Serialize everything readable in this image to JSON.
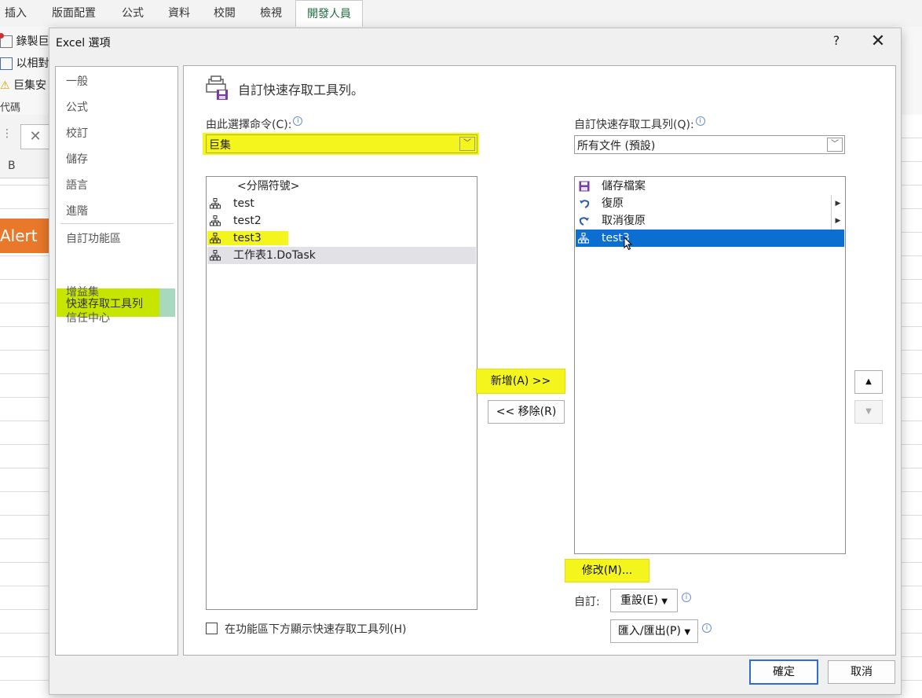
{
  "excel": {
    "tabs": [
      "插入",
      "版面配置",
      "公式",
      "資料",
      "校閱",
      "檢視",
      "開發人員"
    ],
    "active_tab": "開發人員",
    "ribbon_items": [
      "錄製巨",
      "以相對",
      "巨集安"
    ],
    "ribbon_code_label": "代碼",
    "column_b": "B",
    "orange_button_text": "Alert m"
  },
  "dialog": {
    "title": "Excel 選項",
    "help": "?",
    "close": "✕",
    "nav": [
      "一般",
      "公式",
      "校訂",
      "儲存",
      "語言",
      "進階",
      "自訂功能區",
      "快速存取工具列",
      "增益集",
      "信任中心"
    ],
    "header": "自訂快速存取工具列。",
    "choose_label": "由此選擇命令(C):",
    "choose_value": "巨集",
    "qat_label": "自訂快速存取工具列(Q):",
    "qat_value": "所有文件 (預設)",
    "left_list": [
      {
        "text": "<分隔符號>"
      },
      {
        "text": "test"
      },
      {
        "text": "test2"
      },
      {
        "text": "test3"
      },
      {
        "text": "工作表1.DoTask"
      }
    ],
    "right_list": [
      {
        "text": "儲存檔案"
      },
      {
        "text": "復原"
      },
      {
        "text": "取消復原"
      },
      {
        "text": "test3"
      }
    ],
    "add_button": "新增(A) >>",
    "remove_button": "<< 移除(R)",
    "modify_button": "修改(M)...",
    "custom_label": "自訂:",
    "reset_button": "重設(E)",
    "import_export_button": "匯入/匯出(P)",
    "show_below_label": "在功能區下方顯示快速存取工具列(H)",
    "ok": "確定",
    "cancel": "取消"
  }
}
